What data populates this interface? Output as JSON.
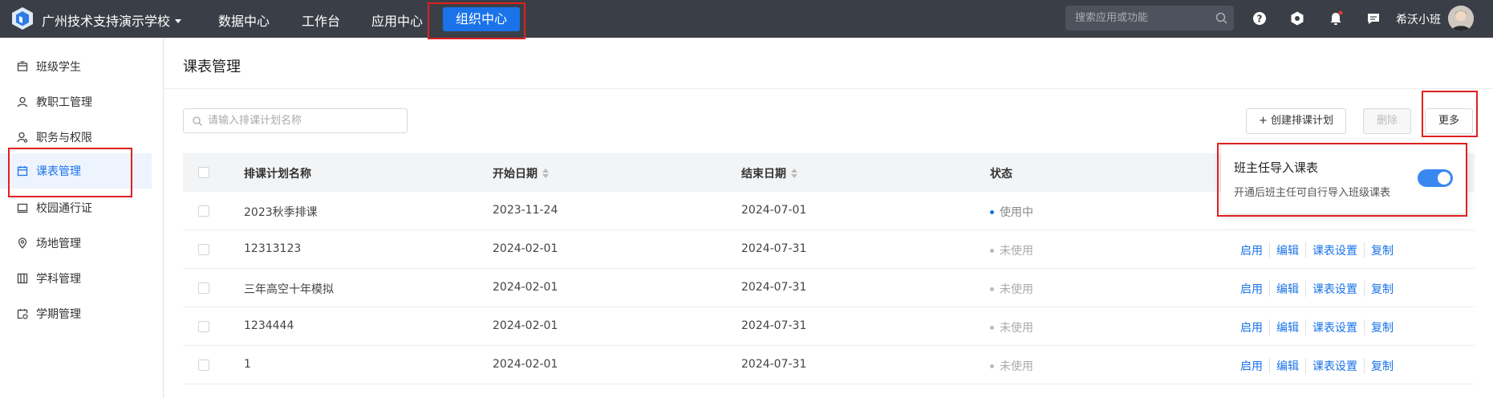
{
  "topbar": {
    "school_name": "广州技术支持演示学校",
    "nav": [
      "数据中心",
      "工作台",
      "应用中心"
    ],
    "nav_active": "组织中心",
    "search_placeholder": "搜索应用或功能",
    "username": "希沃小班"
  },
  "sidebar": {
    "items": [
      {
        "label": "班级学生",
        "icon": "class-icon"
      },
      {
        "label": "教职工管理",
        "icon": "user-icon"
      },
      {
        "label": "职务与权限",
        "icon": "user-key-icon"
      },
      {
        "label": "课表管理",
        "icon": "calendar-icon",
        "active": true
      },
      {
        "label": "校园通行证",
        "icon": "pass-card-icon"
      },
      {
        "label": "场地管理",
        "icon": "location-pin-icon"
      },
      {
        "label": "学科管理",
        "icon": "book-icon"
      },
      {
        "label": "学期管理",
        "icon": "calendar-clock-icon"
      }
    ]
  },
  "main": {
    "page_title": "课表管理",
    "filter_placeholder": "请输入排课计划名称",
    "buttons": {
      "create": "+ 创建排课计划",
      "delete": "删除",
      "more": "更多"
    }
  },
  "table": {
    "headers": {
      "name": "排课计划名称",
      "start": "开始日期",
      "end": "结束日期",
      "status": "状态"
    },
    "rows": [
      {
        "name": "2023秋季排课",
        "start": "2023-11-24",
        "end": "2024-07-01",
        "status": "使用中"
      },
      {
        "name": "12313123",
        "start": "2024-02-01",
        "end": "2024-07-31",
        "status": "未使用"
      },
      {
        "name": "三年高空十年模拟",
        "start": "2024-02-01",
        "end": "2024-07-31",
        "status": "未使用"
      },
      {
        "name": "1234444",
        "start": "2024-02-01",
        "end": "2024-07-31",
        "status": "未使用"
      },
      {
        "name": "1",
        "start": "2024-02-01",
        "end": "2024-07-31",
        "status": "未使用"
      }
    ],
    "actions": [
      "启用",
      "编辑",
      "课表设置",
      "复制"
    ]
  },
  "popover": {
    "title": "班主任导入课表",
    "description": "开通后班主任可自行导入班级课表",
    "toggle_on": true
  },
  "colors": {
    "topbar": "#3a3f47",
    "accent": "#1a73e8",
    "status_active": "#1a73e8",
    "status_inactive": "#bbbbbb",
    "annotation": "#e0201f"
  }
}
